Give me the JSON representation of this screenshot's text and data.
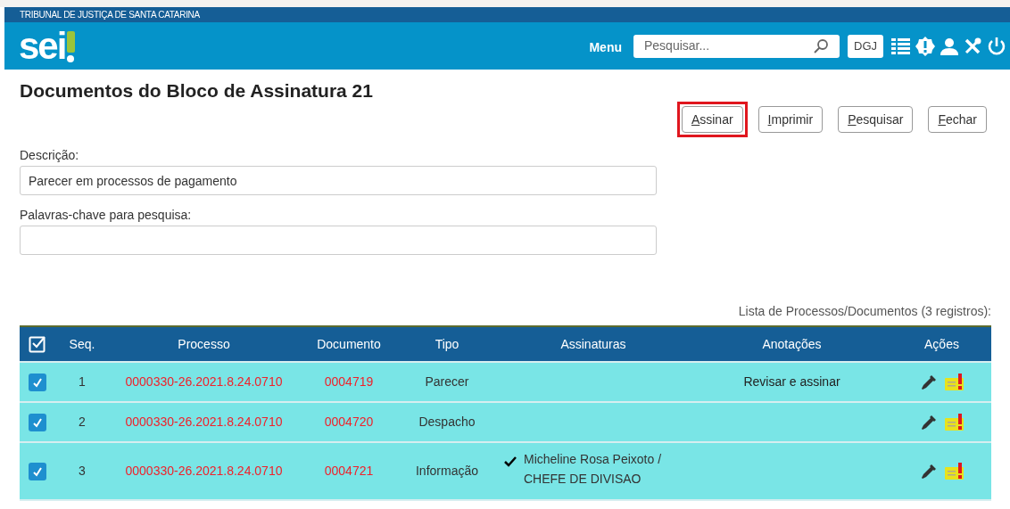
{
  "header": {
    "org": "TRIBUNAL DE JUSTIÇA DE SANTA CATARINA",
    "logo": "sei",
    "menu": "Menu",
    "search": {
      "placeholder": "Pesquisar..."
    },
    "unit": "DGJ"
  },
  "page": {
    "title": "Documentos do Bloco de Assinatura 21"
  },
  "buttons": [
    {
      "label": "Assinar",
      "highlighted": true
    },
    {
      "label": "Imprimir",
      "highlighted": false
    },
    {
      "label": "Pesquisar",
      "highlighted": false
    },
    {
      "label": "Fechar",
      "highlighted": false
    }
  ],
  "fields": [
    {
      "label": "Descrição:",
      "value": "Parecer em processos de pagamento"
    },
    {
      "label": "Palavras-chave para pesquisa:"
    }
  ],
  "table": {
    "caption": "Lista de Processos/Documentos (3 registros):",
    "columns": [
      "Seq.",
      "Processo",
      "Documento",
      "Tipo",
      "Assinaturas",
      "Anotações",
      "Ações"
    ],
    "rows": [
      {
        "checked": true,
        "seq": "1",
        "processo": "0000330-26.2021.8.24.0710",
        "documento": "0004719",
        "tipo": "Parecer",
        "assinaturas": [],
        "anotacoes": "Revisar e assinar"
      },
      {
        "checked": true,
        "seq": "2",
        "processo": "0000330-26.2021.8.24.0710",
        "documento": "0004720",
        "tipo": "Despacho",
        "assinaturas": []
      },
      {
        "checked": true,
        "seq": "3",
        "processo": "0000330-26.2021.8.24.0710",
        "documento": "0004721",
        "tipo": "Informação",
        "assinaturas": [
          {
            "signed": true,
            "name": "Micheline Rosa Peixoto / CHEFE DE DIVISAO"
          }
        ]
      }
    ]
  }
}
